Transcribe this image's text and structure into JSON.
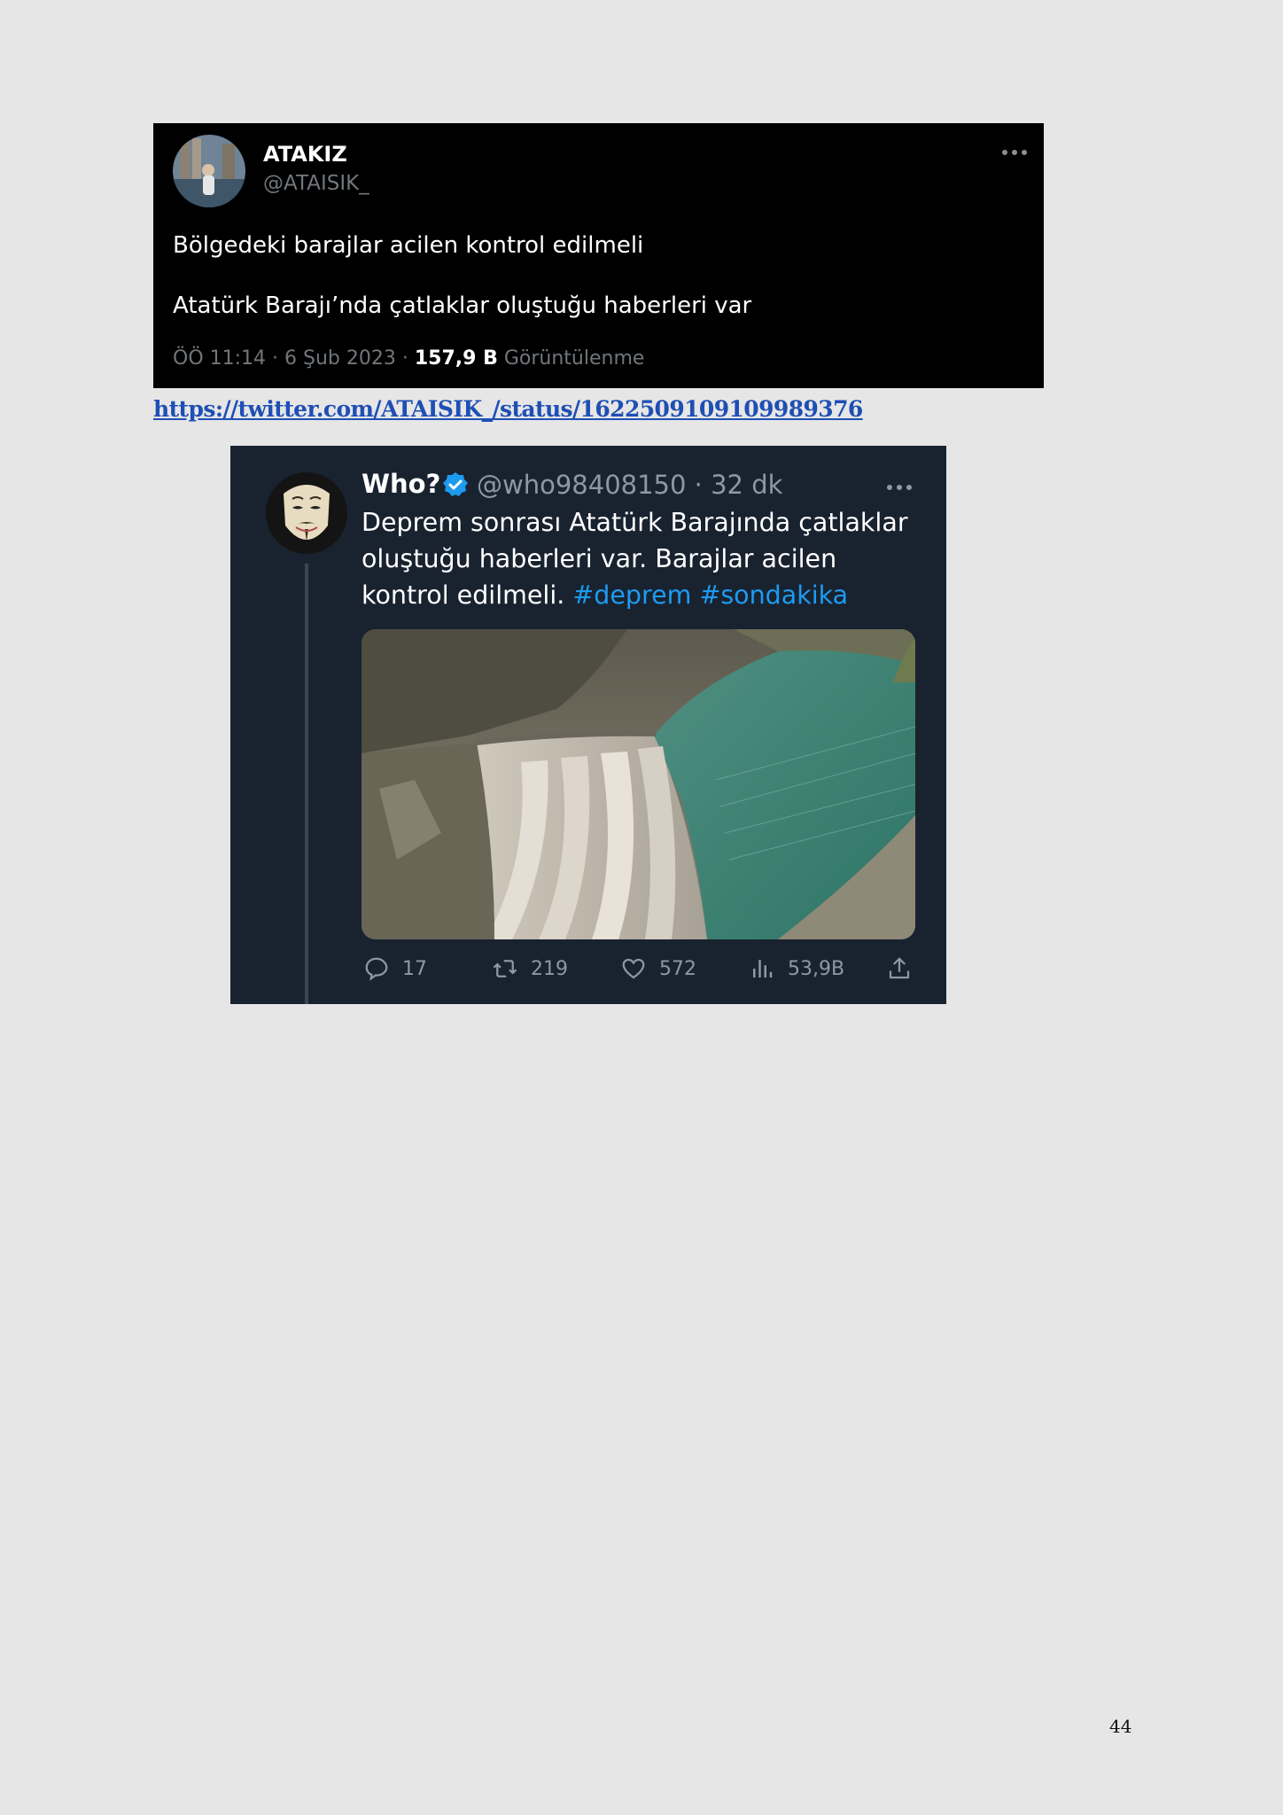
{
  "tweet1": {
    "display_name": "ATAKIZ",
    "handle": "@ATAISIK_",
    "more_icon": "more-horizontal-icon",
    "line1": "Bölgedeki barajlar acilen kontrol edilmeli",
    "line2": "Atatürk Barajı’nda çatlaklar oluştuğu haberleri var",
    "meta_prefix": "ÖÖ 11:14 · 6 Şub 2023 · ",
    "views_count": "157,9 B",
    "views_label": " Görüntülenme"
  },
  "link": {
    "text": "https://twitter.com/ATAISIK_/status/1622509109109989376"
  },
  "tweet2": {
    "display_name": "Who?",
    "verified_icon": "verified-badge-icon",
    "handle_time": "@who98408150 · 32 dk",
    "text_plain": "Deprem sonrası Atatürk Barajında çatlaklar oluştuğu haberleri var. Barajlar acilen kontrol edilmeli. ",
    "hashtag1": "#deprem",
    "hashtag2": "#sondakika",
    "actions": {
      "reply_count": "17",
      "retweet_count": "219",
      "like_count": "572",
      "views_count": "53,9B"
    },
    "colors": {
      "background": "#192330",
      "hashtag": "#1d9bf0"
    }
  },
  "page_number": "44"
}
